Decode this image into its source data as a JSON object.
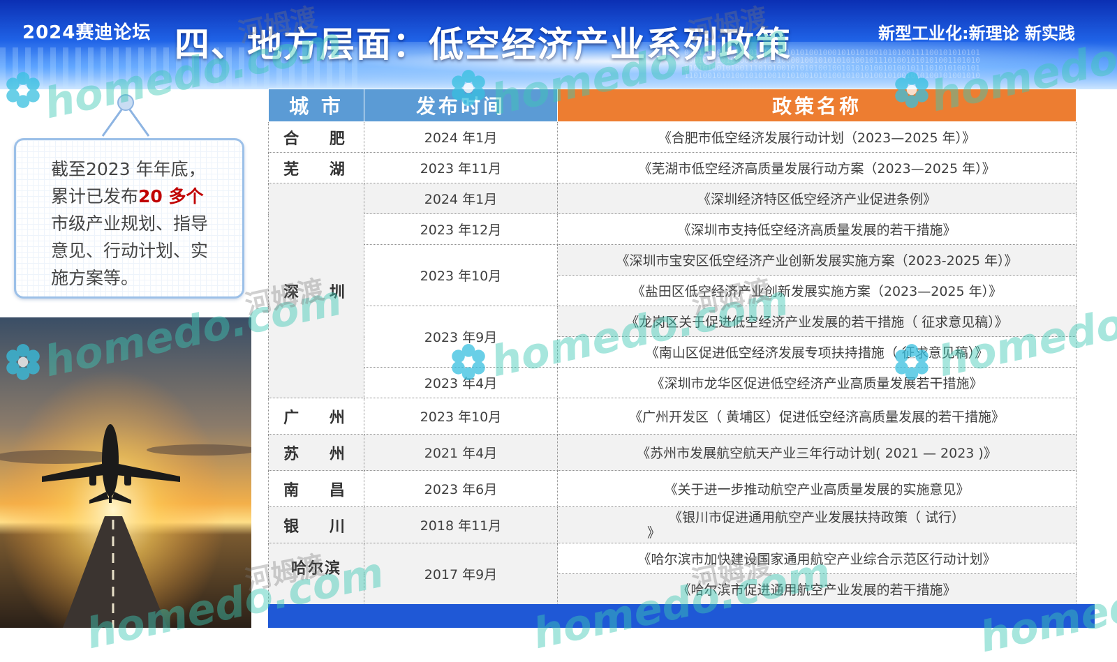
{
  "header": {
    "event": "2024赛迪论坛",
    "title": "四、地方层面：低空经济产业系列政策",
    "slogan": "新型工业化:新理论 新实践"
  },
  "card": {
    "line1": "截至2023 年年底，",
    "line2_prefix": "累计已发布",
    "line2_highlight": "20 多个",
    "line3": "市级产业规划、指导",
    "line4": "意见、行动计划、实",
    "line5": "施方案等。"
  },
  "photo": {
    "icon": "airplane-takeoff-icon"
  },
  "table": {
    "headers": [
      "城 市",
      "发布时间",
      "政策名称"
    ],
    "rows": [
      {
        "city": "合 肥",
        "date": "2024 年1月",
        "policy": "《合肥市低空经济发展行动计划（2023—2025 年）》"
      },
      {
        "city": "芜 湖",
        "date": "2023 年11月",
        "policy": "《芜湖市低空经济高质量发展行动方案（2023—2025 年）》"
      },
      {
        "city": "深 圳",
        "date": "2024 年1月",
        "policy": "《深圳经济特区低空经济产业促进条例》"
      },
      {
        "date": "2023 年12月",
        "policy": "《深圳市支持低空经济高质量发展的若干措施》"
      },
      {
        "date": "2023 年10月",
        "policy": "《深圳市宝安区低空经济产业创新发展实施方案（2023-2025 年）》"
      },
      {
        "policy": "《盐田区低空经济产业创新发展实施方案（2023—2025 年）》"
      },
      {
        "date": "2023 年9月",
        "policy": "《龙岗区关于促进低空经济产业发展的若干措施（ 征求意见稿）》"
      },
      {
        "policy": "《南山区促进低空经济发展专项扶持措施（ 征求意见稿）》"
      },
      {
        "date": "2023 年4月",
        "policy": "《深圳市龙华区促进低空经济产业高质量发展若干措施》"
      },
      {
        "city": "广 州",
        "date": "2023 年10月",
        "policy": "《广州开发区（ 黄埔区）促进低空经济高质量发展的若干措施》"
      },
      {
        "city": "苏 州",
        "date": "2021 年4月",
        "policy": "《苏州市发展航空航天产业三年行动计划( 2021 — 2023 )》"
      },
      {
        "city": "南 昌",
        "date": "2023 年6月",
        "policy": "《关于进一步推动航空产业高质量发展的实施意见》"
      },
      {
        "city": "银 川",
        "date": "2018 年11月",
        "policy_line1": "《银川市促进通用航空产业发展扶持政策（ 试行）",
        "policy_line2": "》"
      },
      {
        "city": "哈尔滨",
        "date": "2017 年9月",
        "policy": "《哈尔滨市加快建设国家通用航空产业综合示范区行动计划》"
      },
      {
        "policy": "《哈尔滨市促进通用航空产业发展的若干措施》"
      }
    ]
  },
  "watermarks": {
    "latin": "homedo.com",
    "chinese": "河姆渡",
    "logo_icon": "homedo-flower-logo-icon"
  },
  "colors": {
    "header_blue": "#1f62e6",
    "table_header_blue": "#5b9bd5",
    "table_header_orange": "#ed7d31",
    "highlight_red": "#c00000"
  }
}
